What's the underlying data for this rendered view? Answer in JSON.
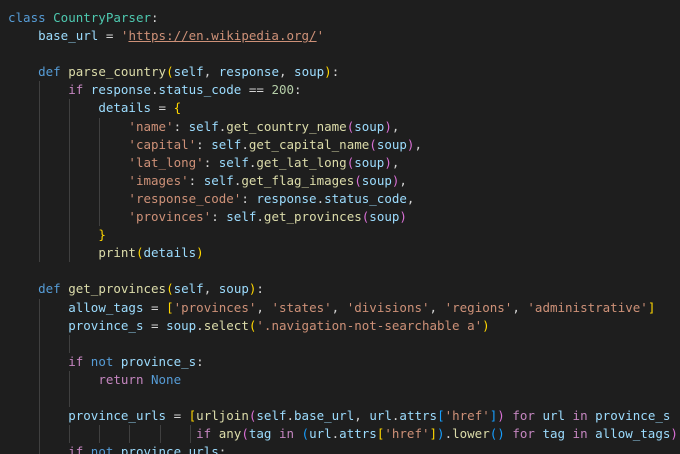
{
  "editor": {
    "language": "python",
    "theme": "dark",
    "background": "#1e1e1e",
    "token_colors": {
      "keyword": "#569cd6",
      "control": "#c586c0",
      "class": "#4ec9b0",
      "function": "#dcdcaa",
      "variable": "#9cdcfe",
      "string": "#ce9178",
      "number": "#b5cea8",
      "plain": "#d4d4d4",
      "bracket1": "#ffd700",
      "bracket2": "#da70d6",
      "bracket3": "#179fff"
    },
    "lines": [
      {
        "indent": 0,
        "tokens": [
          {
            "t": "keyword",
            "v": "class "
          },
          {
            "t": "class",
            "v": "CountryParser"
          },
          {
            "t": "plain",
            "v": ":"
          }
        ]
      },
      {
        "indent": 1,
        "tokens": [
          {
            "t": "variable",
            "v": "base_url"
          },
          {
            "t": "plain",
            "v": " = "
          },
          {
            "t": "string",
            "v": "'"
          },
          {
            "t": "url",
            "v": "https://en.wikipedia.org/"
          },
          {
            "t": "string",
            "v": "'"
          }
        ]
      },
      {
        "indent": 0,
        "tokens": []
      },
      {
        "indent": 1,
        "tokens": [
          {
            "t": "keyword",
            "v": "def "
          },
          {
            "t": "function",
            "v": "parse_country"
          },
          {
            "t": "bracket1",
            "v": "("
          },
          {
            "t": "variable",
            "v": "self"
          },
          {
            "t": "plain",
            "v": ", "
          },
          {
            "t": "variable",
            "v": "response"
          },
          {
            "t": "plain",
            "v": ", "
          },
          {
            "t": "variable",
            "v": "soup"
          },
          {
            "t": "bracket1",
            "v": ")"
          },
          {
            "t": "plain",
            "v": ":"
          }
        ]
      },
      {
        "indent": 2,
        "tokens": [
          {
            "t": "control",
            "v": "if "
          },
          {
            "t": "variable",
            "v": "response"
          },
          {
            "t": "plain",
            "v": "."
          },
          {
            "t": "variable",
            "v": "status_code"
          },
          {
            "t": "plain",
            "v": " == "
          },
          {
            "t": "number",
            "v": "200"
          },
          {
            "t": "plain",
            "v": ":"
          }
        ]
      },
      {
        "indent": 3,
        "tokens": [
          {
            "t": "variable",
            "v": "details"
          },
          {
            "t": "plain",
            "v": " = "
          },
          {
            "t": "bracket1",
            "v": "{"
          }
        ]
      },
      {
        "indent": 4,
        "tokens": [
          {
            "t": "string",
            "v": "'name'"
          },
          {
            "t": "plain",
            "v": ": "
          },
          {
            "t": "variable",
            "v": "self"
          },
          {
            "t": "plain",
            "v": "."
          },
          {
            "t": "function",
            "v": "get_country_name"
          },
          {
            "t": "bracket2",
            "v": "("
          },
          {
            "t": "variable",
            "v": "soup"
          },
          {
            "t": "bracket2",
            "v": ")"
          },
          {
            "t": "plain",
            "v": ","
          }
        ]
      },
      {
        "indent": 4,
        "tokens": [
          {
            "t": "string",
            "v": "'capital'"
          },
          {
            "t": "plain",
            "v": ": "
          },
          {
            "t": "variable",
            "v": "self"
          },
          {
            "t": "plain",
            "v": "."
          },
          {
            "t": "function",
            "v": "get_capital_name"
          },
          {
            "t": "bracket2",
            "v": "("
          },
          {
            "t": "variable",
            "v": "soup"
          },
          {
            "t": "bracket2",
            "v": ")"
          },
          {
            "t": "plain",
            "v": ","
          }
        ]
      },
      {
        "indent": 4,
        "tokens": [
          {
            "t": "string",
            "v": "'lat_long'"
          },
          {
            "t": "plain",
            "v": ": "
          },
          {
            "t": "variable",
            "v": "self"
          },
          {
            "t": "plain",
            "v": "."
          },
          {
            "t": "function",
            "v": "get_lat_long"
          },
          {
            "t": "bracket2",
            "v": "("
          },
          {
            "t": "variable",
            "v": "soup"
          },
          {
            "t": "bracket2",
            "v": ")"
          },
          {
            "t": "plain",
            "v": ","
          }
        ]
      },
      {
        "indent": 4,
        "tokens": [
          {
            "t": "string",
            "v": "'images'"
          },
          {
            "t": "plain",
            "v": ": "
          },
          {
            "t": "variable",
            "v": "self"
          },
          {
            "t": "plain",
            "v": "."
          },
          {
            "t": "function",
            "v": "get_flag_images"
          },
          {
            "t": "bracket2",
            "v": "("
          },
          {
            "t": "variable",
            "v": "soup"
          },
          {
            "t": "bracket2",
            "v": ")"
          },
          {
            "t": "plain",
            "v": ","
          }
        ]
      },
      {
        "indent": 4,
        "tokens": [
          {
            "t": "string",
            "v": "'response_code'"
          },
          {
            "t": "plain",
            "v": ": "
          },
          {
            "t": "variable",
            "v": "response"
          },
          {
            "t": "plain",
            "v": "."
          },
          {
            "t": "variable",
            "v": "status_code"
          },
          {
            "t": "plain",
            "v": ","
          }
        ]
      },
      {
        "indent": 4,
        "tokens": [
          {
            "t": "string",
            "v": "'provinces'"
          },
          {
            "t": "plain",
            "v": ": "
          },
          {
            "t": "variable",
            "v": "self"
          },
          {
            "t": "plain",
            "v": "."
          },
          {
            "t": "function",
            "v": "get_provinces"
          },
          {
            "t": "bracket2",
            "v": "("
          },
          {
            "t": "variable",
            "v": "soup"
          },
          {
            "t": "bracket2",
            "v": ")"
          }
        ]
      },
      {
        "indent": 3,
        "tokens": [
          {
            "t": "bracket1",
            "v": "}"
          }
        ]
      },
      {
        "indent": 3,
        "tokens": [
          {
            "t": "function",
            "v": "print"
          },
          {
            "t": "bracket1",
            "v": "("
          },
          {
            "t": "variable",
            "v": "details"
          },
          {
            "t": "bracket1",
            "v": ")"
          }
        ]
      },
      {
        "indent": 0,
        "tokens": []
      },
      {
        "indent": 1,
        "tokens": [
          {
            "t": "keyword",
            "v": "def "
          },
          {
            "t": "function",
            "v": "get_provinces"
          },
          {
            "t": "bracket1",
            "v": "("
          },
          {
            "t": "variable",
            "v": "self"
          },
          {
            "t": "plain",
            "v": ", "
          },
          {
            "t": "variable",
            "v": "soup"
          },
          {
            "t": "bracket1",
            "v": ")"
          },
          {
            "t": "plain",
            "v": ":"
          }
        ]
      },
      {
        "indent": 2,
        "tokens": [
          {
            "t": "variable",
            "v": "allow_tags"
          },
          {
            "t": "plain",
            "v": " = "
          },
          {
            "t": "bracket1",
            "v": "["
          },
          {
            "t": "string",
            "v": "'provinces'"
          },
          {
            "t": "plain",
            "v": ", "
          },
          {
            "t": "string",
            "v": "'states'"
          },
          {
            "t": "plain",
            "v": ", "
          },
          {
            "t": "string",
            "v": "'divisions'"
          },
          {
            "t": "plain",
            "v": ", "
          },
          {
            "t": "string",
            "v": "'regions'"
          },
          {
            "t": "plain",
            "v": ", "
          },
          {
            "t": "string",
            "v": "'administrative'"
          },
          {
            "t": "bracket1",
            "v": "]"
          }
        ]
      },
      {
        "indent": 2,
        "tokens": [
          {
            "t": "variable",
            "v": "province_s"
          },
          {
            "t": "plain",
            "v": " = "
          },
          {
            "t": "variable",
            "v": "soup"
          },
          {
            "t": "plain",
            "v": "."
          },
          {
            "t": "function",
            "v": "select"
          },
          {
            "t": "bracket1",
            "v": "("
          },
          {
            "t": "string",
            "v": "'.navigation-not-searchable a'"
          },
          {
            "t": "bracket1",
            "v": ")"
          }
        ]
      },
      {
        "indent": 0,
        "tokens": [],
        "guides": 2
      },
      {
        "indent": 2,
        "tokens": [
          {
            "t": "control",
            "v": "if "
          },
          {
            "t": "keyword",
            "v": "not "
          },
          {
            "t": "variable",
            "v": "province_s"
          },
          {
            "t": "plain",
            "v": ":"
          }
        ]
      },
      {
        "indent": 3,
        "tokens": [
          {
            "t": "control",
            "v": "return "
          },
          {
            "t": "keyword",
            "v": "None"
          }
        ]
      },
      {
        "indent": 0,
        "tokens": [],
        "guides": 2
      },
      {
        "indent": 2,
        "tokens": [
          {
            "t": "variable",
            "v": "province_urls"
          },
          {
            "t": "plain",
            "v": " = "
          },
          {
            "t": "bracket1",
            "v": "["
          },
          {
            "t": "function",
            "v": "urljoin"
          },
          {
            "t": "bracket2",
            "v": "("
          },
          {
            "t": "variable",
            "v": "self"
          },
          {
            "t": "plain",
            "v": "."
          },
          {
            "t": "variable",
            "v": "base_url"
          },
          {
            "t": "plain",
            "v": ", "
          },
          {
            "t": "variable",
            "v": "url"
          },
          {
            "t": "plain",
            "v": "."
          },
          {
            "t": "variable",
            "v": "attrs"
          },
          {
            "t": "bracket3",
            "v": "["
          },
          {
            "t": "string",
            "v": "'href'"
          },
          {
            "t": "bracket3",
            "v": "]"
          },
          {
            "t": "bracket2",
            "v": ")"
          },
          {
            "t": "control",
            "v": " for "
          },
          {
            "t": "variable",
            "v": "url"
          },
          {
            "t": "control",
            "v": " in "
          },
          {
            "t": "variable",
            "v": "province_s"
          }
        ]
      },
      {
        "indent": 0,
        "pad": 25,
        "guides": 6,
        "tokens": [
          {
            "t": "control",
            "v": "if "
          },
          {
            "t": "function",
            "v": "any"
          },
          {
            "t": "bracket2",
            "v": "("
          },
          {
            "t": "variable",
            "v": "tag"
          },
          {
            "t": "control",
            "v": " in "
          },
          {
            "t": "bracket3",
            "v": "("
          },
          {
            "t": "variable",
            "v": "url"
          },
          {
            "t": "plain",
            "v": "."
          },
          {
            "t": "variable",
            "v": "attrs"
          },
          {
            "t": "bracket1",
            "v": "["
          },
          {
            "t": "string",
            "v": "'href'"
          },
          {
            "t": "bracket1",
            "v": "]"
          },
          {
            "t": "bracket3",
            "v": ")"
          },
          {
            "t": "plain",
            "v": "."
          },
          {
            "t": "function",
            "v": "lower"
          },
          {
            "t": "bracket3",
            "v": "()"
          },
          {
            "t": "control",
            "v": " for "
          },
          {
            "t": "variable",
            "v": "tag"
          },
          {
            "t": "control",
            "v": " in "
          },
          {
            "t": "variable",
            "v": "allow_tags"
          },
          {
            "t": "bracket2",
            "v": ")"
          },
          {
            "t": "bracket1",
            "v": "]"
          }
        ]
      },
      {
        "indent": 2,
        "tokens": [
          {
            "t": "control",
            "v": "if "
          },
          {
            "t": "keyword",
            "v": "not "
          },
          {
            "t": "variable",
            "v": "province_urls"
          },
          {
            "t": "plain",
            "v": ":"
          }
        ]
      }
    ]
  }
}
